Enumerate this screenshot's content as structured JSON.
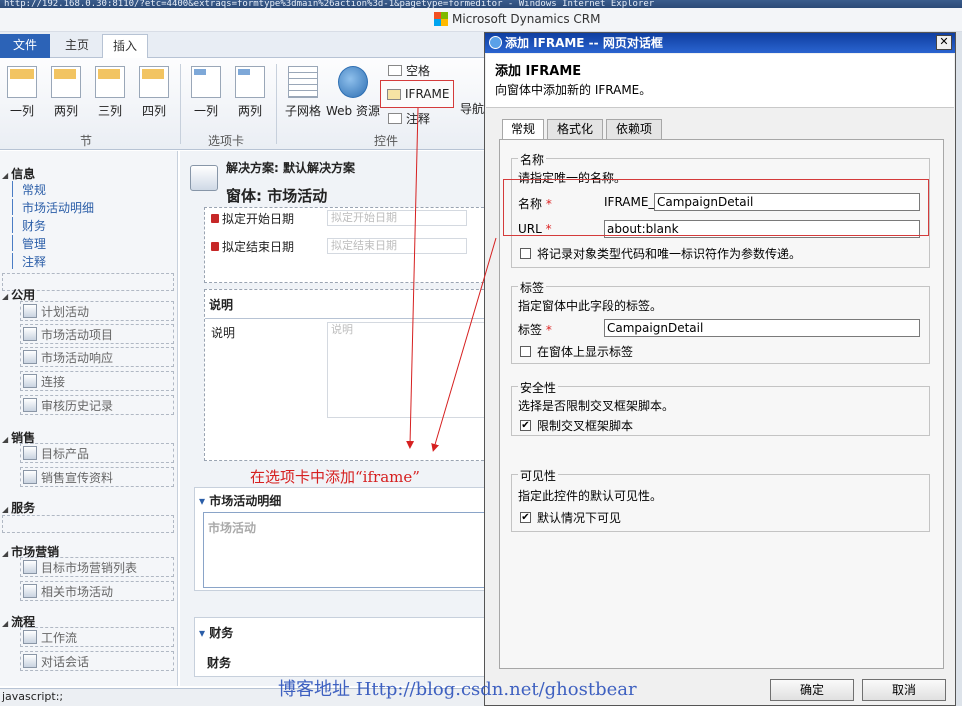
{
  "browser": {
    "titlebar_text": "http://192.168.0.30:8110/?etc=4400&extraqs=formtype%3dmain%26action%3d-1&pagetype=formeditor - Windows Internet Explorer"
  },
  "brand": {
    "name": "Microsoft Dynamics CRM"
  },
  "ribbon": {
    "tabs": {
      "file": "文件",
      "home": "主页",
      "insert": "插入"
    },
    "section_buttons": {
      "one_col": "一列",
      "two_col": "两列",
      "three_col": "三列",
      "four_col": "四列"
    },
    "tab_buttons": {
      "one_col": "一列",
      "two_col": "两列"
    },
    "control_buttons": {
      "subgrid": "子网格",
      "web_resource": "Web 资源",
      "spacer": "空格",
      "iframe": "IFRAME",
      "notes": "注释",
      "nav_link": "导航链接"
    },
    "groups": {
      "section": "节",
      "tab": "选项卡",
      "control": "控件"
    }
  },
  "leftnav": {
    "info": {
      "title": "信息",
      "links": [
        "常规",
        "市场活动明细",
        "财务",
        "管理",
        "注释"
      ]
    },
    "common": {
      "title": "公用",
      "items": [
        "计划活动",
        "市场活动项目",
        "市场活动响应",
        "连接",
        "审核历史记录"
      ]
    },
    "sales": {
      "title": "销售",
      "items": [
        "目标产品",
        "销售宣传资料"
      ]
    },
    "service": {
      "title": "服务"
    },
    "marketing": {
      "title": "市场营销",
      "items": [
        "目标市场营销列表",
        "相关市场活动"
      ]
    },
    "process": {
      "title": "流程",
      "items": [
        "工作流",
        "对话会话"
      ]
    }
  },
  "form": {
    "solution": "解决方案: 默认解决方案",
    "entity": "窗体: 市场活动",
    "fields": {
      "start_label": "拟定开始日期",
      "start_placeholder": "拟定开始日期",
      "end_label": "拟定结束日期",
      "end_placeholder": "拟定结束日期"
    },
    "desc_section": "说明",
    "desc_label": "说明",
    "desc_placeholder": "说明",
    "detail_section": "市场活动明细",
    "detail_field": "市场活动",
    "finance_section": "财务",
    "finance_sub": "财务"
  },
  "annotation": "在选项卡中添加“iframe”",
  "watermark": "博客地址 Http://blog.csdn.net/ghostbear",
  "statusbar": "javascript:;",
  "dialog": {
    "title": "添加 IFRAME -- 网页对话框",
    "heading": "添加 IFRAME",
    "subheading": "向窗体中添加新的 IFRAME。",
    "tabs": [
      "常规",
      "格式化",
      "依赖项"
    ],
    "name_group": {
      "legend": "名称",
      "desc": "请指定唯一的名称。",
      "name_label": "名称",
      "name_prefix": "IFRAME_",
      "name_value": "CampaignDetail",
      "url_label": "URL",
      "url_value": "about:blank",
      "pass_params": "将记录对象类型代码和唯一标识符作为参数传递。"
    },
    "label_group": {
      "legend": "标签",
      "desc": "指定窗体中此字段的标签。",
      "label_label": "标签",
      "label_value": "CampaignDetail",
      "show_label": "在窗体上显示标签"
    },
    "security_group": {
      "legend": "安全性",
      "desc": "选择是否限制交叉框架脚本。",
      "restrict": "限制交叉框架脚本"
    },
    "visibility_group": {
      "legend": "可见性",
      "desc": "指定此控件的默认可见性。",
      "visible": "默认情况下可见"
    },
    "buttons": {
      "ok": "确定",
      "cancel": "取消"
    },
    "close_glyph": "✕",
    "required_marker": "*",
    "checked_glyph": "✔"
  },
  "colors": {
    "accent": "#2c63b7",
    "annotation_red": "#d62020",
    "dialog_title": "#0f3ea0",
    "watermark_blue": "#2048b8"
  }
}
